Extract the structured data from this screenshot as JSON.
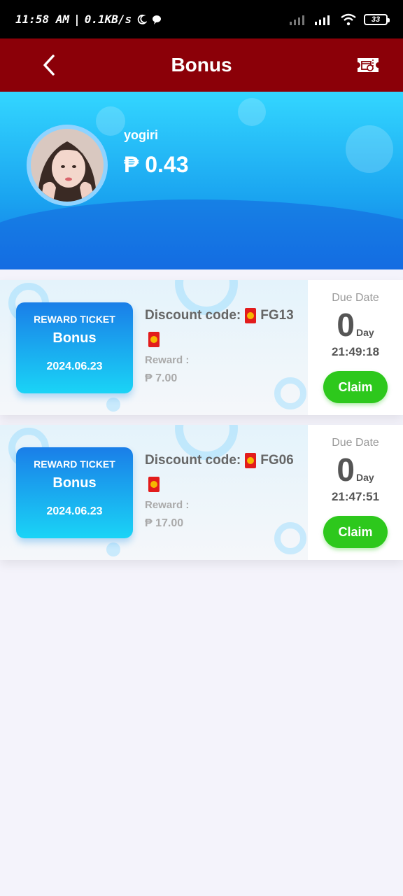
{
  "status_bar": {
    "time": "11:58 AM",
    "separator": "|",
    "speed": "0.1KB/s",
    "battery": "33"
  },
  "header": {
    "title": "Bonus"
  },
  "profile": {
    "username": "yogiri",
    "balance": "₱ 0.43"
  },
  "tickets": [
    {
      "label": "REWARD TICKET",
      "name": "Bonus",
      "date": "2024.06.23",
      "discount_label": "Discount code:",
      "code": "FG13",
      "reward_label": "Reward :",
      "reward_amount": "₱ 7.00",
      "due_label": "Due Date",
      "due_days": "0",
      "due_unit": "Day",
      "due_time": "21:49:18",
      "claim_label": "Claim"
    },
    {
      "label": "REWARD TICKET",
      "name": "Bonus",
      "date": "2024.06.23",
      "discount_label": "Discount code:",
      "code": "FG06",
      "reward_label": "Reward :",
      "reward_amount": "₱ 17.00",
      "due_label": "Due Date",
      "due_days": "0",
      "due_unit": "Day",
      "due_time": "21:47:51",
      "claim_label": "Claim"
    }
  ],
  "colors": {
    "header": "#8b0008",
    "claim": "#2dc81c",
    "banner": "#1aa4f0"
  }
}
